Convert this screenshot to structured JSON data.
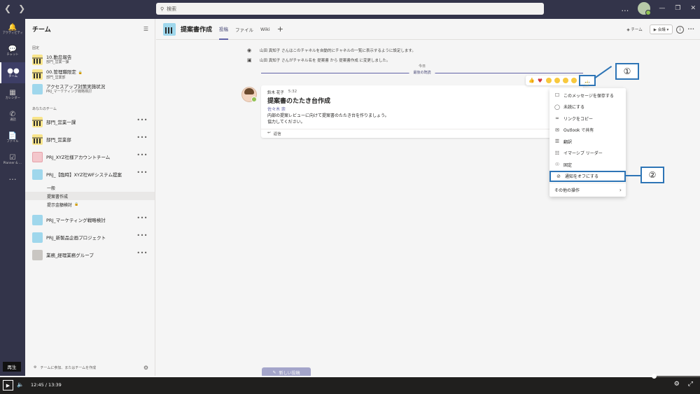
{
  "titlebar": {
    "search_placeholder": "検索",
    "more_label": "…"
  },
  "rail": {
    "items": [
      {
        "icon": "bell-icon",
        "label": "アクティビティ"
      },
      {
        "icon": "chat-icon",
        "label": "チャット"
      },
      {
        "icon": "teams-icon",
        "label": "チーム"
      },
      {
        "icon": "calendar-icon",
        "label": "カレンダー"
      },
      {
        "icon": "call-icon",
        "label": "通話"
      },
      {
        "icon": "files-icon",
        "label": "ファイル"
      },
      {
        "icon": "planner-icon",
        "label": "Planner & ..."
      }
    ],
    "more_label": "…"
  },
  "panel": {
    "title": "チーム",
    "pinned_label": "固定",
    "pinned": [
      {
        "name": "10.勤怠報告",
        "sub": "部門_営業一課"
      },
      {
        "name": "00.管理職限定",
        "sub": "部門_営業部"
      },
      {
        "name": "アクセスアップ対策実施状況",
        "sub": "PRJ_マーケティング戦略検討"
      }
    ],
    "your_teams_label": "あなたのチーム",
    "teams": [
      {
        "name": "部門_営業一課"
      },
      {
        "name": "部門_営業部"
      },
      {
        "name": "PRJ_XYZ社様アカウントチーム"
      },
      {
        "name": "PRJ_【臨時】XYZ社WFシステム提案"
      }
    ],
    "channels": [
      {
        "name": "一般"
      },
      {
        "name": "提案書作成"
      },
      {
        "name": "提示金額検討"
      }
    ],
    "teams_after": [
      {
        "name": "PRJ_マーケティング戦略検討"
      },
      {
        "name": "PRJ_新製品企画プロジェクト"
      },
      {
        "name": "業務_経理業務グループ"
      }
    ],
    "footer_text": "チームに参加、またはチームを作成"
  },
  "channel_header": {
    "title": "提案書作成",
    "tabs": [
      "投稿",
      "ファイル",
      "Wiki"
    ],
    "team_label": "チーム",
    "meet_label": "会議"
  },
  "feed": {
    "system_messages": [
      "山田 真知子 さんはこのチャネルを自動的にチャネルの一覧に表示するように設定します。",
      "山田 真知子 さんがチャネル名を 提案書 から 提案書作成 に変更しました。"
    ],
    "today_label": "今日",
    "last_read_label": "最後の既読",
    "message": {
      "author": "鈴木 花子",
      "time": "5:32",
      "subject": "提案書のたたき台作成",
      "mention": "佐々木 崇",
      "line1": "内部の提案レビューに向けて提案書のたたき台を作りましょう。",
      "line2": "協力してください。",
      "reply_label": "返信"
    },
    "more_button_label": "…",
    "new_post_label": "新しい投稿"
  },
  "context_menu": {
    "items": [
      {
        "icon": "bookmark-icon",
        "label": "このメッセージを保存する"
      },
      {
        "icon": "unread-icon",
        "label": "未読にする"
      },
      {
        "icon": "link-icon",
        "label": "リンクをコピー"
      },
      {
        "icon": "mail-icon",
        "label": "Outlook で共有"
      },
      {
        "icon": "translate-icon",
        "label": "翻訳"
      },
      {
        "icon": "reader-icon",
        "label": "イマーシブ リーダー"
      },
      {
        "icon": "pin-icon",
        "label": "固定"
      },
      {
        "icon": "bell-off-icon",
        "label": "通知をオフにする"
      }
    ],
    "more_actions_label": "その他の操作"
  },
  "callouts": {
    "one": "①",
    "two": "②"
  },
  "player": {
    "tooltip": "再生",
    "time": "12:45 / 13:39",
    "progress_fraction": 0.934
  },
  "colors": {
    "teams_purple": "#6264a7",
    "rail_bg": "#33344a",
    "callout_blue": "#2e75b6"
  }
}
